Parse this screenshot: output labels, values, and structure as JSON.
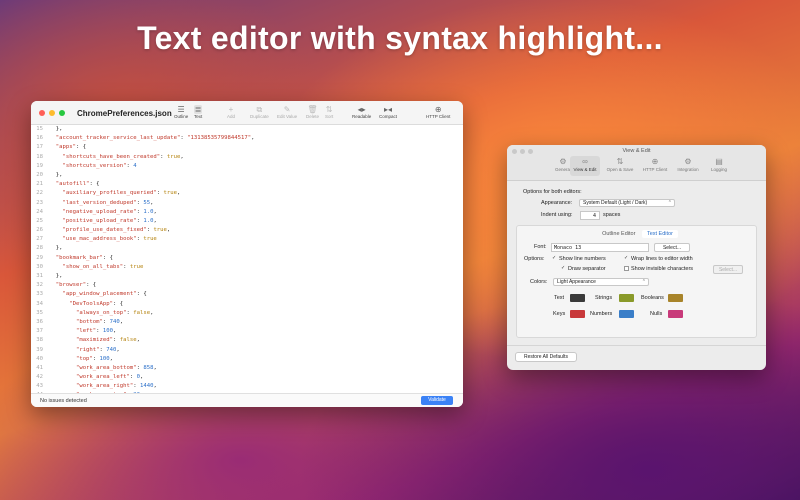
{
  "headline": "Text editor with syntax highlight...",
  "editor": {
    "file_name": "ChromePreferences.json",
    "toolbar": [
      {
        "label": "Outline",
        "icon": "outline-icon",
        "glyph": "☰",
        "state": "normal"
      },
      {
        "label": "Text",
        "icon": "text-icon",
        "glyph": "≣",
        "state": "selected"
      },
      {
        "label": "Add",
        "icon": "add-icon",
        "glyph": "+",
        "state": "disabled"
      },
      {
        "label": "Duplicate",
        "icon": "duplicate-icon",
        "glyph": "⧉",
        "state": "disabled"
      },
      {
        "label": "Edit Value",
        "icon": "pencil-icon",
        "glyph": "✎",
        "state": "disabled"
      },
      {
        "label": "Delete",
        "icon": "trash-icon",
        "glyph": "🗑",
        "state": "disabled"
      },
      {
        "label": "Sort",
        "icon": "sort-icon",
        "glyph": "⇅",
        "state": "disabled"
      },
      {
        "label": "Readable",
        "icon": "expand-icon",
        "glyph": "◂▸",
        "state": "normal"
      },
      {
        "label": "Compact",
        "icon": "compact-icon",
        "glyph": "▸◂",
        "state": "normal"
      },
      {
        "label": "HTTP Client",
        "icon": "globe-icon",
        "glyph": "⊕",
        "state": "normal"
      }
    ],
    "code_lines": [
      {
        "n": "15",
        "t": "  },"
      },
      {
        "n": "16",
        "t": "  \"account_tracker_service_last_update\": \"13138535799844517\","
      },
      {
        "n": "17",
        "t": "  \"apps\": {"
      },
      {
        "n": "18",
        "t": "    \"shortcuts_have_been_created\": true,"
      },
      {
        "n": "19",
        "t": "    \"shortcuts_version\": 4"
      },
      {
        "n": "20",
        "t": "  },"
      },
      {
        "n": "21",
        "t": "  \"autofill\": {"
      },
      {
        "n": "22",
        "t": "    \"auxiliary_profiles_queried\": true,"
      },
      {
        "n": "23",
        "t": "    \"last_version_deduped\": 55,"
      },
      {
        "n": "24",
        "t": "    \"negative_upload_rate\": 1.0,"
      },
      {
        "n": "25",
        "t": "    \"positive_upload_rate\": 1.0,"
      },
      {
        "n": "26",
        "t": "    \"profile_use_dates_fixed\": true,"
      },
      {
        "n": "27",
        "t": "    \"use_mac_address_book\": true"
      },
      {
        "n": "28",
        "t": "  },"
      },
      {
        "n": "29",
        "t": "  \"bookmark_bar\": {"
      },
      {
        "n": "30",
        "t": "    \"show_on_all_tabs\": true"
      },
      {
        "n": "31",
        "t": "  },"
      },
      {
        "n": "32",
        "t": "  \"browser\": {"
      },
      {
        "n": "33",
        "t": "    \"app_window_placement\": {"
      },
      {
        "n": "34",
        "t": "      \"DevToolsApp\": {"
      },
      {
        "n": "35",
        "t": "        \"always_on_top\": false,"
      },
      {
        "n": "36",
        "t": "        \"bottom\": 740,"
      },
      {
        "n": "37",
        "t": "        \"left\": 100,"
      },
      {
        "n": "38",
        "t": "        \"maximized\": false,"
      },
      {
        "n": "39",
        "t": "        \"right\": 740,"
      },
      {
        "n": "40",
        "t": "        \"top\": 100,"
      },
      {
        "n": "41",
        "t": "        \"work_area_bottom\": 858,"
      },
      {
        "n": "42",
        "t": "        \"work_area_left\": 0,"
      },
      {
        "n": "43",
        "t": "        \"work_area_right\": 1440,"
      },
      {
        "n": "44",
        "t": "        \"work_area_top\": 23"
      }
    ],
    "status": "No issues detected",
    "validate_label": "Validate"
  },
  "prefs": {
    "title": "View & Edit",
    "tabs": [
      {
        "label": "General",
        "icon": "gear-icon",
        "glyph": "⚙",
        "selected": false
      },
      {
        "label": "View & Edit",
        "icon": "glasses-icon",
        "glyph": "∞",
        "selected": true
      },
      {
        "label": "Open & Save",
        "icon": "arrows-icon",
        "glyph": "⇅",
        "selected": false
      },
      {
        "label": "HTTP Client",
        "icon": "globe-icon",
        "glyph": "⊕",
        "selected": false
      },
      {
        "label": "Integration",
        "icon": "gears-icon",
        "glyph": "⚙",
        "selected": false
      },
      {
        "label": "Logging",
        "icon": "document-icon",
        "glyph": "▤",
        "selected": false
      }
    ],
    "options_heading": "Options for both editors:",
    "appearance_label": "Appearance:",
    "appearance_value": "System Default (Light / Dark)",
    "indent_label": "Indent using:",
    "indent_value": "4",
    "indent_unit": "spaces",
    "segments": [
      "Outline Editor",
      "Text Editor"
    ],
    "font_label": "Font:",
    "font_value": "Monaco 13",
    "font_button": "Select...",
    "options_label": "Options:",
    "checkboxes": [
      {
        "label": "Show line numbers",
        "checked": true
      },
      {
        "label": "Wrap lines to editor width",
        "checked": true
      },
      {
        "label": "Draw separator",
        "checked": true
      },
      {
        "label": "Show invisible characters",
        "checked": false
      }
    ],
    "invisible_button": "Select...",
    "colors_label": "Colors:",
    "colors_value": "Light Appearance",
    "swatches": [
      {
        "label": "Text",
        "color": "#3a3a3a"
      },
      {
        "label": "Strings",
        "color": "#8a9a2a"
      },
      {
        "label": "Booleans",
        "color": "#a8842a"
      },
      {
        "label": "Keys",
        "color": "#c8383a"
      },
      {
        "label": "Numbers",
        "color": "#3a7ec8"
      },
      {
        "label": "Nulls",
        "color": "#c83a7a"
      }
    ],
    "restore_label": "Restore All Defaults"
  }
}
